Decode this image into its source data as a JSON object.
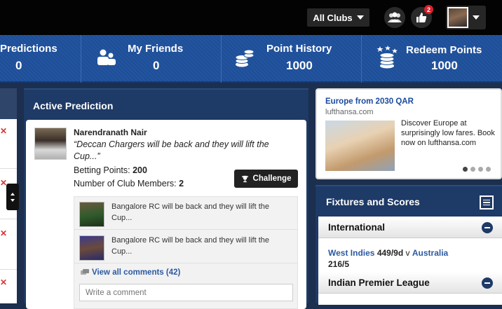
{
  "topbar": {
    "clubs_label": "All Clubs",
    "notifications_count": "2"
  },
  "stats": [
    {
      "label": "Predictions",
      "value": "0",
      "icon": "predictions-icon"
    },
    {
      "label": "My Friends",
      "value": "0",
      "icon": "friends-icon"
    },
    {
      "label": "Point History",
      "value": "1000",
      "icon": "coins-stack-icon"
    },
    {
      "label": "Redeem Points",
      "value": "1000",
      "icon": "coins-stars-icon"
    }
  ],
  "active_prediction": {
    "title": "Active Prediction",
    "user_name": "Narendranath Nair",
    "quote": "“Deccan Chargers will be back and they will lift the Cup...”",
    "betting_label": "Betting Points: ",
    "betting_points": "200",
    "members_label": "Number of Club Members: ",
    "members_count": "2",
    "challenge_label": "Challenge",
    "comments": [
      {
        "text": "Bangalore RC will be back and they will lift the Cup..."
      },
      {
        "text": "Bangalore RC will be back and they will lift the Cup..."
      }
    ],
    "view_all_label": "View all comments (42)",
    "comment_placeholder": "Write a comment"
  },
  "ad": {
    "title": "Europe from 2030 QAR",
    "domain": "lufthansa.com",
    "body": "Discover Europe at surprisingly low fares. Book now on lufthansa.com",
    "dots": 4,
    "active_dot": 0
  },
  "fixtures": {
    "title": "Fixtures and Scores",
    "groups": [
      {
        "name": "International"
      },
      {
        "name": "Indian Premier League"
      }
    ],
    "match": {
      "team1": "West Indies",
      "score1": "449/9d",
      "vs": "v",
      "team2": "Australia",
      "score2": "216/5"
    }
  },
  "colors": {
    "accent_blue": "#1f4e98",
    "panel_navy": "#1e3a66",
    "link_blue": "#2c5aa0",
    "badge_red": "#d8202a"
  }
}
